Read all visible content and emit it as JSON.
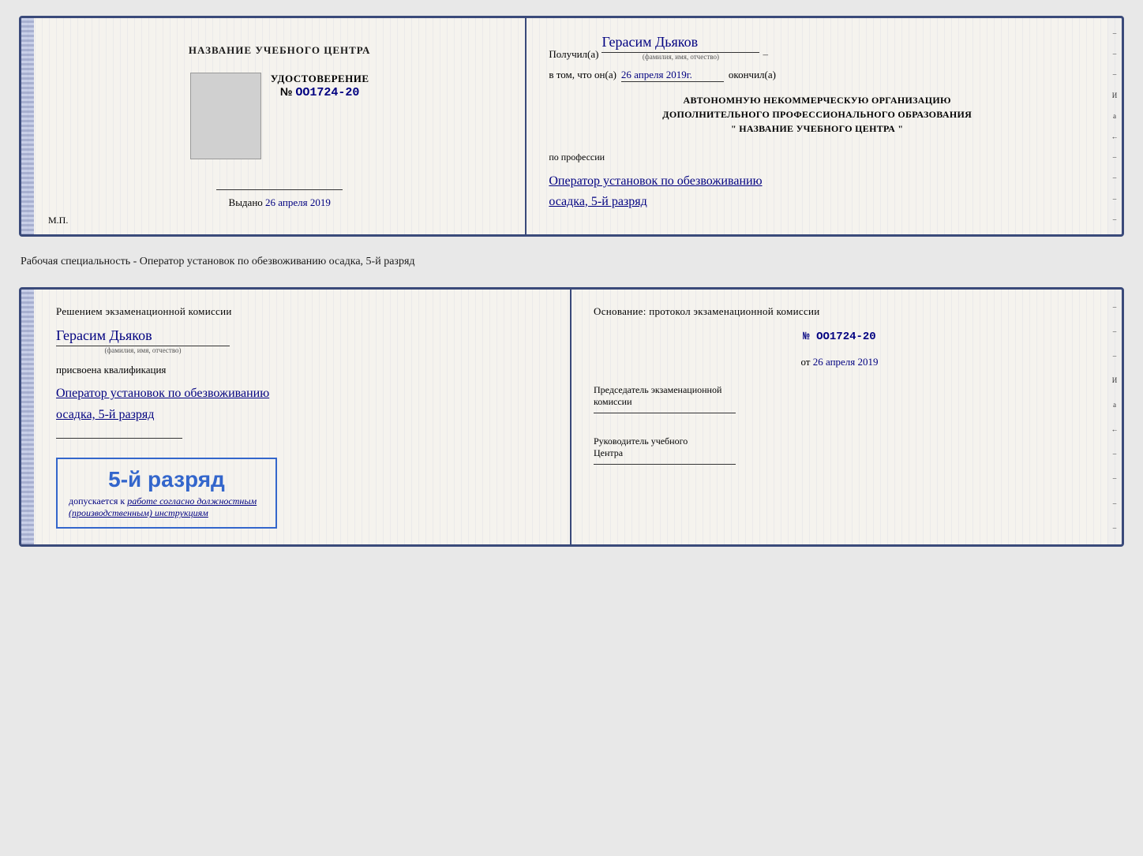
{
  "doc1": {
    "left": {
      "title": "НАЗВАНИЕ УЧЕБНОГО ЦЕНТРА",
      "udost_label": "УДОСТОВЕРЕНИЕ",
      "number_prefix": "№",
      "number": "OO1724-20",
      "vydano_label": "Выдано",
      "vydano_date": "26 апреля 2019",
      "mp": "М.П."
    },
    "right": {
      "poluchil_label": "Получил(а)",
      "recipient_name": "Герасим Дьяков",
      "recipient_sublabel": "(фамилия, имя, отчество)",
      "vtom_label": "в том, что он(а)",
      "vtom_date": "26 апреля 2019г.",
      "okончил_label": "окончил(а)",
      "org_line1": "АВТОНОМНУЮ НЕКОММЕРЧЕСКУЮ ОРГАНИЗАЦИЮ",
      "org_line2": "ДОПОЛНИТЕЛЬНОГО ПРОФЕССИОНАЛЬНОГО ОБРАЗОВАНИЯ",
      "org_line3": "\"   НАЗВАНИЕ УЧЕБНОГО ЦЕНТРА   \"",
      "professiya_label": "по профессии",
      "profession": "Оператор установок по обезвоживанию",
      "profession2": "осадка, 5-й разряд",
      "dash1": "–",
      "dash2": "–",
      "dash3": "–"
    }
  },
  "separator": {
    "text": "Рабочая специальность - Оператор установок по обезвоживанию осадка, 5-й разряд"
  },
  "doc2": {
    "left": {
      "resheniem": "Решением экзаменационной комиссии",
      "name": "Герасим Дьяков",
      "name_sublabel": "(фамилия, имя, отчество)",
      "prisvoena": "присвоена квалификация",
      "qualification1": "Оператор установок по обезвоживанию",
      "qualification2": "осадка, 5-й разряд",
      "stamp_rank": "5-й разряд",
      "stamp_dopusk_prefix": "допускается к",
      "stamp_dopusk_text": "работе согласно должностным",
      "stamp_dopusk_text2": "(производственным) инструкциям"
    },
    "right": {
      "osnovanie": "Основание: протокол экзаменационной комиссии",
      "number_prefix": "№",
      "number": "OO1724-20",
      "ot_prefix": "от",
      "ot_date": "26 апреля 2019",
      "predsedatel_line1": "Председатель экзаменационной",
      "predsedatel_line2": "комиссии",
      "rukovoditel_line1": "Руководитель учебного",
      "rukovoditel_line2": "Центра",
      "mark1": "–",
      "mark2": "–",
      "mark3": "–",
      "mark4": "И",
      "mark5": "а",
      "mark6": "←"
    }
  }
}
